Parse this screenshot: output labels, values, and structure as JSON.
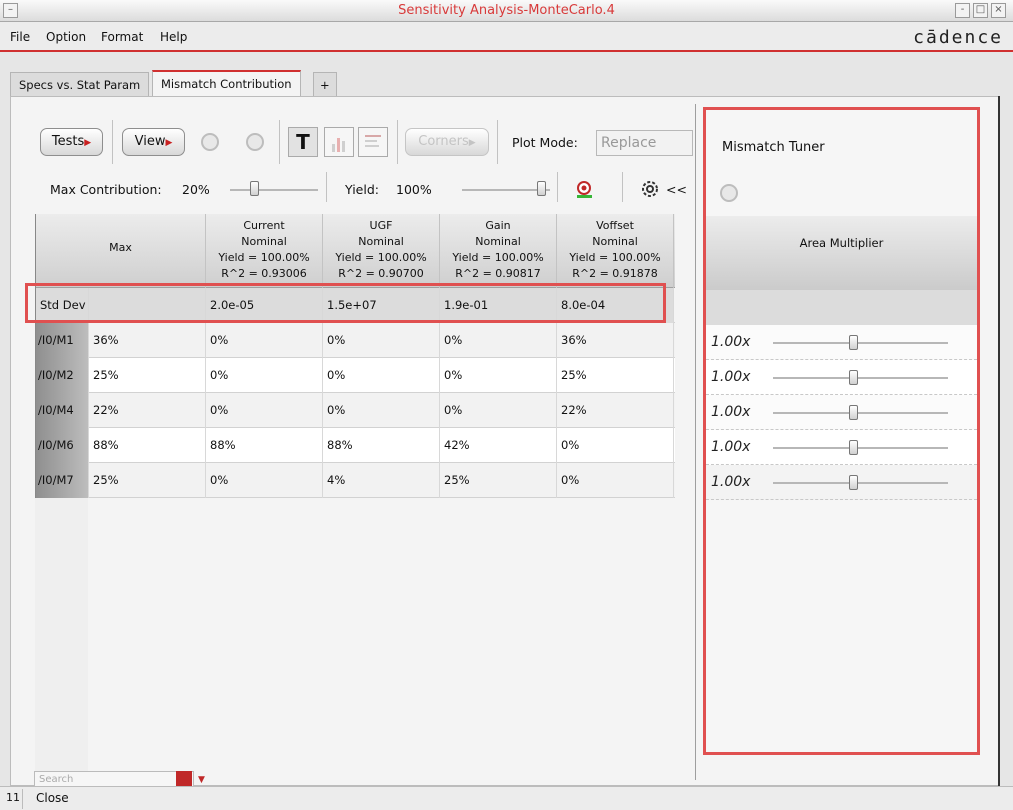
{
  "window": {
    "title": "Sensitivity Analysis-MonteCarlo.4"
  },
  "menu": {
    "file": "File",
    "option": "Option",
    "format": "Format",
    "help": "Help",
    "logo": "cādence"
  },
  "tabs": {
    "specs": "Specs vs. Stat Param",
    "mismatch": "Mismatch Contribution",
    "add": "+"
  },
  "toolbar": {
    "tests": "Tests",
    "view": "View",
    "corners": "Corners",
    "plot_mode_label": "Plot Mode:",
    "plot_mode_value": "Replace",
    "text_toggle": "T",
    "max_contribution_label": "Max Contribution:",
    "max_contribution_value": "20%",
    "yield_label": "Yield:",
    "yield_value": "100%",
    "collapse": "<<"
  },
  "table": {
    "headers": [
      {
        "lines": [
          "Max"
        ]
      },
      {
        "lines": [
          "Current",
          "Nominal",
          "Yield = 100.00%",
          "R^2 = 0.93006"
        ]
      },
      {
        "lines": [
          "UGF",
          "Nominal",
          "Yield = 100.00%",
          "R^2 = 0.90700"
        ]
      },
      {
        "lines": [
          "Gain",
          "Nominal",
          "Yield = 100.00%",
          "R^2 = 0.90817"
        ]
      },
      {
        "lines": [
          "Voffset",
          "Nominal",
          "Yield = 100.00%",
          "R^2 = 0.91878"
        ]
      }
    ],
    "std_dev": {
      "label": "Std Dev",
      "values": [
        "",
        "2.0e-05",
        "1.5e+07",
        "1.9e-01",
        "8.0e-04"
      ]
    },
    "rows": [
      {
        "name": "/I0/M1",
        "values": [
          "36%",
          "0%",
          "0%",
          "0%",
          "36%"
        ]
      },
      {
        "name": "/I0/M2",
        "values": [
          "25%",
          "0%",
          "0%",
          "0%",
          "25%"
        ]
      },
      {
        "name": "/I0/M4",
        "values": [
          "22%",
          "0%",
          "0%",
          "0%",
          "22%"
        ]
      },
      {
        "name": "/I0/M6",
        "values": [
          "88%",
          "88%",
          "88%",
          "42%",
          "0%"
        ]
      },
      {
        "name": "/I0/M7",
        "values": [
          "25%",
          "0%",
          "4%",
          "25%",
          "0%"
        ]
      }
    ]
  },
  "tuner": {
    "title": "Mismatch Tuner",
    "column": "Area Multiplier",
    "multipliers": [
      "1.00x",
      "1.00x",
      "1.00x",
      "1.00x",
      "1.00x"
    ]
  },
  "search": {
    "placeholder": "Search"
  },
  "status": {
    "number": "11",
    "close": "Close"
  }
}
